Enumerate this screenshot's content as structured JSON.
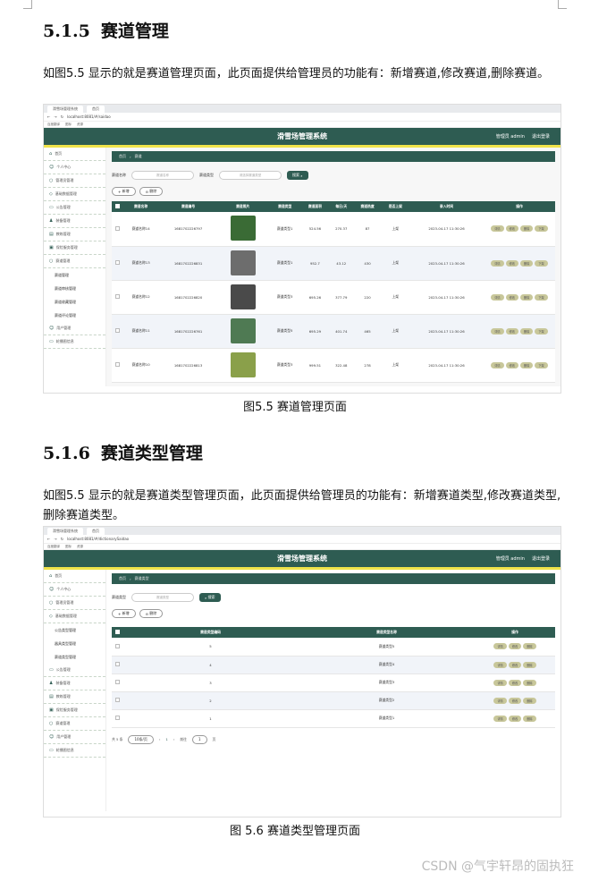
{
  "section1": {
    "heading_num": "5.1.5",
    "heading_text": "赛道管理",
    "paragraph": "如图5.5 显示的就是赛道管理页面，此页面提供给管理员的功能有：新增赛道,修改赛道,删除赛道。",
    "caption": "图5.5 赛道管理页面"
  },
  "section2": {
    "heading_num": "5.1.6",
    "heading_text": "赛道类型管理",
    "paragraph": "如图5.5 显示的就是赛道类型管理页面，此页面提供给管理员的功能有：新增赛道类型,修改赛道类型,删除赛道类型。",
    "caption": "图 5.6  赛道类型管理页面"
  },
  "shot1": {
    "tab_title": "滑雪场管理系统",
    "tab2": "首页",
    "url": "localhost:8081/#/saidao",
    "bookmarks": [
      "百度翻译",
      "图标",
      "资源"
    ],
    "app_title": "滑雪场管理系统",
    "user": "管理员 admin",
    "logout": "退出登录",
    "sidebar": [
      "首页",
      "个人中心",
      "管理员管理",
      "基础数据管理",
      "公告管理",
      "装备管理",
      "教练管理",
      "保险服务管理",
      "赛道管理"
    ],
    "sidebar_sub": [
      "赛道管理",
      "赛道审核管理",
      "赛道收藏管理",
      "赛道评论管理"
    ],
    "sidebar_after": [
      "用户管理",
      "轮播图信息"
    ],
    "crumb_home": "首页",
    "crumb_page": "赛道",
    "search_label1": "赛道名称",
    "search_ph1": "赛道名称",
    "search_label2": "赛道类型",
    "search_ph2": "请选择赛道类型",
    "search_btn": "搜索",
    "add_btn": "新增",
    "del_btn": "删除",
    "columns": [
      "赛道名称",
      "赛道编号",
      "赛道照片",
      "赛道类型",
      "赛道面积",
      "每日/天",
      "赛道热度",
      "是否上架",
      "录入时间",
      "操作"
    ],
    "rows": [
      {
        "name": "赛道名称14",
        "code": "1681702226797",
        "type": "赛道类型1",
        "area": "524.56",
        "price": "270.37",
        "heat": "87",
        "shelf": "上架",
        "time": "2023-04-17 11:30:26",
        "thumb": "#3a6b35"
      },
      {
        "name": "赛道名称13",
        "code": "1681702226831",
        "type": "赛道类型1",
        "area": "952.7",
        "price": "43.12",
        "heat": "430",
        "shelf": "上架",
        "time": "2023-04-17 11:30:26",
        "thumb": "#6d6d6d"
      },
      {
        "name": "赛道名称12",
        "code": "1681702226820",
        "type": "赛道类型3",
        "area": "695.26",
        "price": "377.79",
        "heat": "220",
        "shelf": "上架",
        "time": "2023-04-17 11:30:26",
        "thumb": "#4a4a4a"
      },
      {
        "name": "赛道名称11",
        "code": "1681702226761",
        "type": "赛道类型5",
        "area": "695.29",
        "price": "401.74",
        "heat": "465",
        "shelf": "上架",
        "time": "2023-04-17 11:30:26",
        "thumb": "#4f7a53"
      },
      {
        "name": "赛道名称10",
        "code": "1681702226813",
        "type": "赛道类型3",
        "area": "999.51",
        "price": "322.48",
        "heat": "278",
        "shelf": "上架",
        "time": "2023-04-17 11:30:26",
        "thumb": "#8aa04a"
      }
    ],
    "ops": [
      "详情",
      "修改",
      "删除",
      "下架"
    ]
  },
  "shot2": {
    "url": "localhost:8081/#/dictionarySaidao",
    "crumb_page": "赛道类型",
    "search_label": "赛道类型",
    "search_ph": "赛道类型",
    "search_btn": "搜索",
    "add_btn": "新增",
    "del_btn": "删除",
    "sidebar": [
      "首页",
      "个人中心",
      "管理员管理",
      "基础数据管理"
    ],
    "sidebar_sub": [
      "公告类型管理",
      "器具类型管理",
      "赛道类型管理"
    ],
    "sidebar_after": [
      "公告管理",
      "装备管理",
      "教练管理",
      "保险服务管理",
      "赛道管理",
      "用户管理",
      "轮播图信息"
    ],
    "columns": [
      "赛道类型编码",
      "赛道类型名称",
      "操作"
    ],
    "rows": [
      {
        "code": "5",
        "name": "赛道类型5"
      },
      {
        "code": "4",
        "name": "赛道类型4"
      },
      {
        "code": "3",
        "name": "赛道类型3"
      },
      {
        "code": "2",
        "name": "赛道类型2"
      },
      {
        "code": "1",
        "name": "赛道类型1"
      }
    ],
    "ops": [
      "详情",
      "修改",
      "删除"
    ],
    "pager": {
      "total": "共 5 条",
      "size": "10条/页",
      "page": "1",
      "goto": "前往",
      "goto_page": "1",
      "page_unit": "页"
    }
  },
  "watermark": "CSDN @气宇轩昂的固执狂"
}
